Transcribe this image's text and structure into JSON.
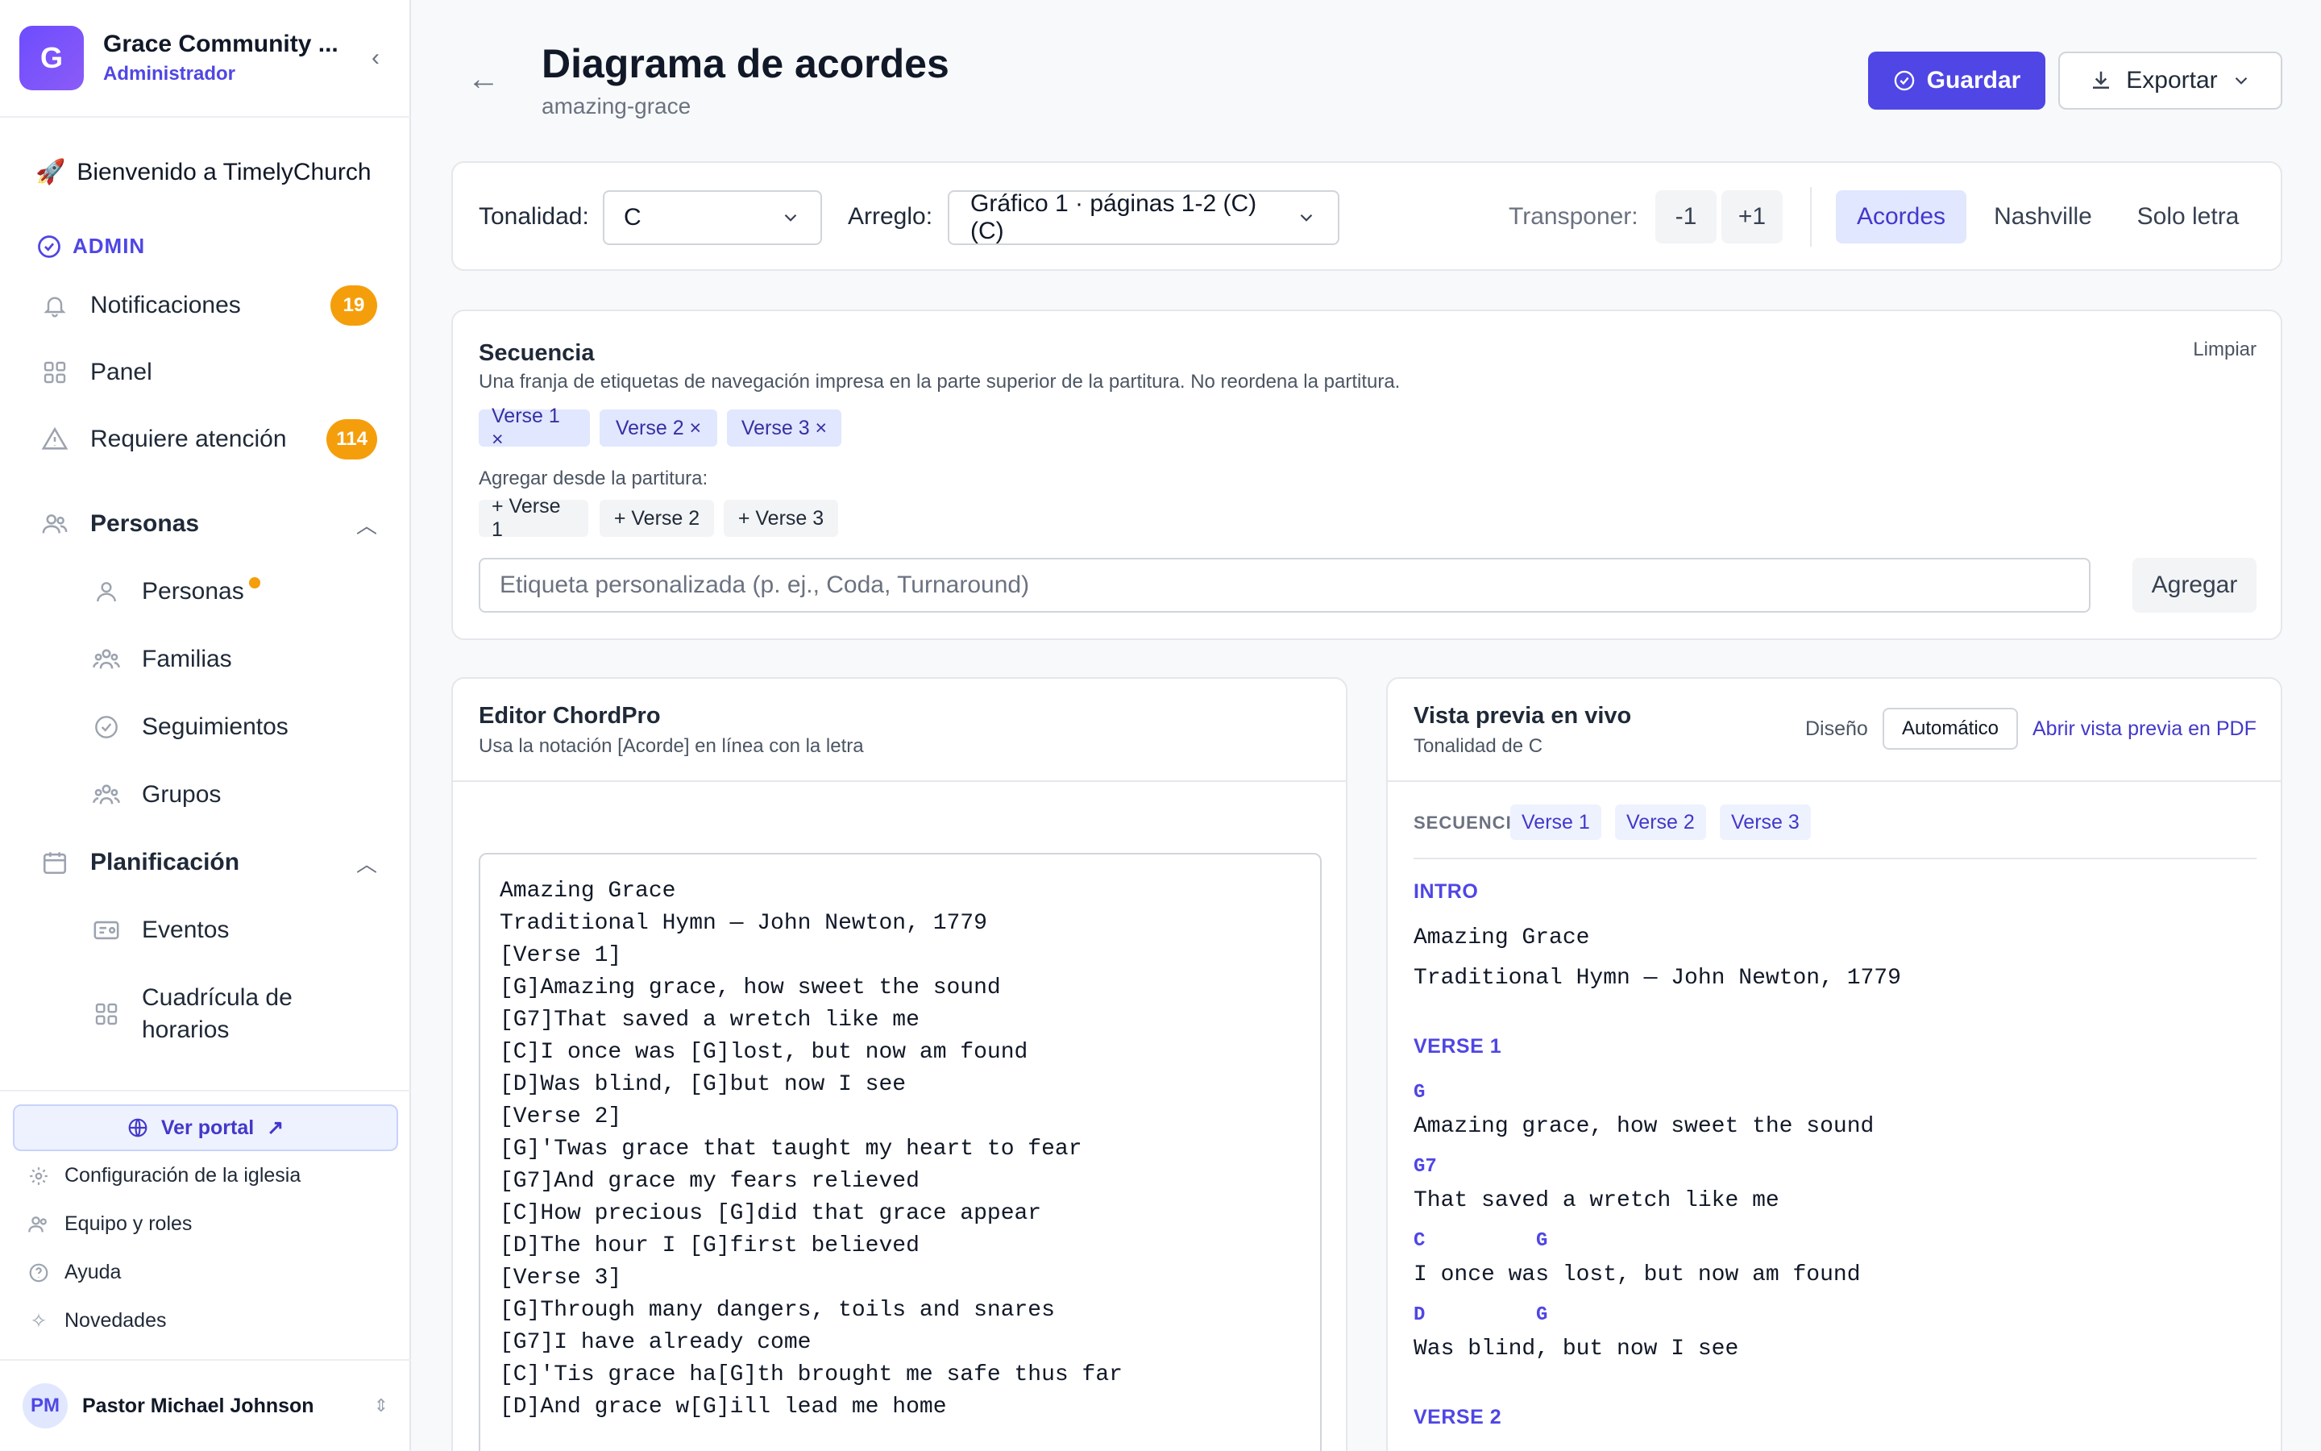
{
  "sidebar": {
    "org_initial": "G",
    "org_name": "Grace Community ...",
    "org_role": "Administrador",
    "welcome": "Bienvenido a TimelyChurch",
    "admin_label": "ADMIN",
    "nav": {
      "notifications": {
        "label": "Notificaciones",
        "badge": "19"
      },
      "panel": {
        "label": "Panel"
      },
      "attention": {
        "label": "Requiere atención",
        "badge": "114"
      }
    },
    "personas_section": "Personas",
    "personas_items": [
      "Personas",
      "Familias",
      "Seguimientos",
      "Grupos"
    ],
    "planning_section": "Planificación",
    "planning_items": [
      "Eventos",
      "Cuadrícula de horarios"
    ],
    "portal_button": "Ver portal",
    "footer_links": [
      "Configuración de la iglesia",
      "Equipo y roles",
      "Ayuda",
      "Novedades"
    ],
    "user": {
      "initials": "PM",
      "name": "Pastor Michael Johnson"
    }
  },
  "header": {
    "title": "Diagrama de acordes",
    "subtitle": "amazing-grace",
    "save_label": "Guardar",
    "export_label": "Exportar"
  },
  "toolbar": {
    "key_label": "Tonalidad:",
    "key_value": "C",
    "arrangement_label": "Arreglo:",
    "arrangement_value": "Gráfico 1 · páginas 1-2 (C) (C)",
    "transpose_label": "Transponer:",
    "transpose_down": "-1",
    "transpose_up": "+1",
    "views": [
      "Acordes",
      "Nashville",
      "Solo letra"
    ],
    "active_view": "Acordes"
  },
  "sequence": {
    "title": "Secuencia",
    "description": "Una franja de etiquetas de navegación impresa en la parte superior de la partitura. No reordena la partitura.",
    "clear_label": "Limpiar",
    "chips": [
      "Verse 1 ×",
      "Verse 2 ×",
      "Verse 3 ×"
    ],
    "add_from_label": "Agregar desde la partitura:",
    "add_chips": [
      "+ Verse 1",
      "+ Verse 2",
      "+ Verse 3"
    ],
    "custom_placeholder": "Etiqueta personalizada (p. ej., Coda, Turnaround)",
    "add_button": "Agregar"
  },
  "editor": {
    "title": "Editor ChordPro",
    "description": "Usa la notación [Acorde] en línea con la letra",
    "content": "Amazing Grace\nTraditional Hymn — John Newton, 1779\n[Verse 1]\n[G]Amazing grace, how sweet the sound\n[G7]That saved a wretch like me\n[C]I once was [G]lost, but now am found\n[D]Was blind, [G]but now I see\n[Verse 2]\n[G]'Twas grace that taught my heart to fear\n[G7]And grace my fears relieved\n[C]How precious [G]did that grace appear\n[D]The hour I [G]first believed\n[Verse 3]\n[G]Through many dangers, toils and snares\n[G7]I have already come\n[C]'Tis grace ha[G]th brought me safe thus far\n[D]And grace w[G]ill lead me home"
  },
  "preview": {
    "title": "Vista previa en vivo",
    "key_text": "Tonalidad de C",
    "design_label": "Diseño",
    "design_value": "Automático",
    "pdf_link": "Abrir vista previa en PDF",
    "seq_label": "SECUENCIA",
    "seq_chips": [
      "Verse 1",
      "Verse 2",
      "Verse 3"
    ],
    "intro_label": "INTRO",
    "intro_lines": [
      "Amazing Grace",
      "Traditional Hymn — John Newton, 1779"
    ],
    "verse1_label": "VERSE 1",
    "verse1": [
      {
        "chords": [
          "G"
        ],
        "lyric": "Amazing grace, how sweet the sound"
      },
      {
        "chords": [
          "G7"
        ],
        "lyric": "That saved a wretch like me"
      },
      {
        "chords": [
          "C",
          "G"
        ],
        "lyric": "I once was lost, but now am found"
      },
      {
        "chords": [
          "D",
          "G"
        ],
        "lyric": "Was blind, but now I see"
      }
    ],
    "verse2_label": "VERSE 2"
  }
}
